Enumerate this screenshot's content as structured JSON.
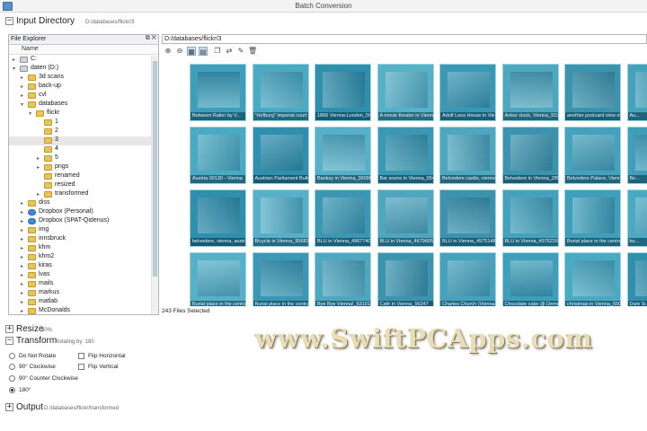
{
  "window": {
    "title": "Batch Conversion"
  },
  "input_directory": {
    "title": "Input Directory",
    "path": "D:/databases/flickr/3",
    "toggle": "−"
  },
  "explorer": {
    "title": "File Explorer",
    "column_name": "Name",
    "tree": [
      {
        "label": "C:",
        "depth": 1,
        "exp": "▸",
        "icon": "drive"
      },
      {
        "label": "daten (D:)",
        "depth": 1,
        "exp": "▾",
        "icon": "drive"
      },
      {
        "label": "3d scans",
        "depth": 2,
        "exp": "▸",
        "icon": "folder"
      },
      {
        "label": "back-up",
        "depth": 2,
        "exp": "▸",
        "icon": "folder"
      },
      {
        "label": "cvl",
        "depth": 2,
        "exp": "▸",
        "icon": "folder"
      },
      {
        "label": "databases",
        "depth": 2,
        "exp": "▾",
        "icon": "folder"
      },
      {
        "label": "flickr",
        "depth": 3,
        "exp": "▾",
        "icon": "folder"
      },
      {
        "label": "1",
        "depth": 4,
        "exp": "",
        "icon": "folder"
      },
      {
        "label": "2",
        "depth": 4,
        "exp": "",
        "icon": "folder"
      },
      {
        "label": "3",
        "depth": 4,
        "exp": "",
        "icon": "folder",
        "selected": true
      },
      {
        "label": "4",
        "depth": 4,
        "exp": "",
        "icon": "folder"
      },
      {
        "label": "5",
        "depth": 4,
        "exp": "▸",
        "icon": "folder"
      },
      {
        "label": "pngs",
        "depth": 4,
        "exp": "▸",
        "icon": "folder"
      },
      {
        "label": "renamed",
        "depth": 4,
        "exp": "",
        "icon": "folder"
      },
      {
        "label": "resized",
        "depth": 4,
        "exp": "",
        "icon": "folder"
      },
      {
        "label": "transformed",
        "depth": 4,
        "exp": "▸",
        "icon": "folder"
      },
      {
        "label": "diss",
        "depth": 2,
        "exp": "▸",
        "icon": "folder"
      },
      {
        "label": "Dropbox (Personal)",
        "depth": 2,
        "exp": "▸",
        "icon": "cloud"
      },
      {
        "label": "Dropbox (SPAT-Qidenus)",
        "depth": 2,
        "exp": "▸",
        "icon": "cloud"
      },
      {
        "label": "img",
        "depth": 2,
        "exp": "▸",
        "icon": "folder"
      },
      {
        "label": "innsbruck",
        "depth": 2,
        "exp": "▸",
        "icon": "folder"
      },
      {
        "label": "khm",
        "depth": 2,
        "exp": "▸",
        "icon": "folder"
      },
      {
        "label": "khm2",
        "depth": 2,
        "exp": "▸",
        "icon": "folder"
      },
      {
        "label": "kiras",
        "depth": 2,
        "exp": "▸",
        "icon": "folder"
      },
      {
        "label": "lvas",
        "depth": 2,
        "exp": "▸",
        "icon": "folder"
      },
      {
        "label": "mails",
        "depth": 2,
        "exp": "▸",
        "icon": "folder"
      },
      {
        "label": "markus",
        "depth": 2,
        "exp": "▸",
        "icon": "folder"
      },
      {
        "label": "matlab",
        "depth": 2,
        "exp": "▸",
        "icon": "folder"
      },
      {
        "label": "McDonalds",
        "depth": 2,
        "exp": "▸",
        "icon": "folder"
      }
    ]
  },
  "viewer": {
    "path": "D:/databases/flickr/3",
    "status": "243 Files Selected",
    "thumbnails": [
      "Between Railer by V...",
      "\"Hofburg\" imperial court",
      "1866 Vienna-London_56",
      "A movie theater in Vienna",
      "Adolf Loos House in Vienna",
      "Anker clock, Vienna_9196",
      "another postcard view of...",
      "Au...",
      "Austria 00130 - Vienna",
      "Austrian Parliament Build...",
      "Banksy in Vienna_36096",
      "Bar scene in Vienna_9549",
      "Belvedere castle, vienna...",
      "Belvedere in Vienna_2896",
      "Belvedere Palace, Vienna...",
      "Be...",
      "belvedere, vienna, austria",
      "Bicycle in Vienna_956838",
      "BLU in Vienna_49677401",
      "BLU in Vienna_46796054",
      "BLU in Vienna_49751483",
      "BLU in Vienna_49752165",
      "Burial place in the central...",
      "bu...",
      "Burial place in the central",
      "Burial place in the central...",
      "Bye Bye Vienna!_6310111",
      "Café in Vienna_96347",
      "Charles Church (Vienna...",
      "Chocolate cake @ Demel",
      "christmas in Vienna_6504",
      "Dark Si..."
    ]
  },
  "resize": {
    "title": "Resize",
    "value": "50%",
    "toggle": "+"
  },
  "transform": {
    "title": "Transform",
    "sub": "Rotating by: 180",
    "toggle": "−",
    "options": {
      "no_rotate": "Do Not Rotate",
      "cw90": "90° Clockwise",
      "ccw90": "90° Counter Clockwise",
      "r180": "180°",
      "flip_h": "Flip Horizontal",
      "flip_v": "Flip Vertical"
    },
    "selected": "r180"
  },
  "output": {
    "title": "Output",
    "path": "D:/databases/flickr/transformed",
    "toggle": "+"
  },
  "watermark": "www.SwiftPCApps.com",
  "colors": {
    "thumb_tint": "#47a6c1",
    "selection": "#e7e7e7"
  }
}
